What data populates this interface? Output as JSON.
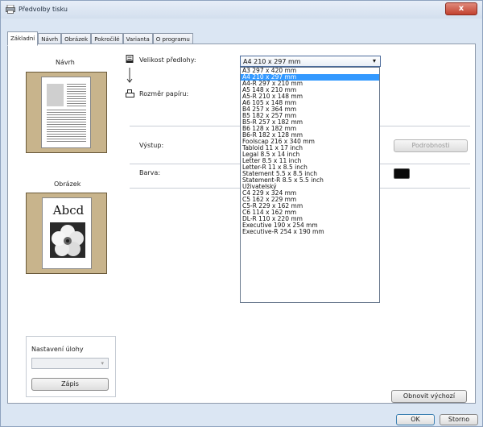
{
  "window": {
    "title": "Předvolby tisku",
    "close_label": "x"
  },
  "tabs": [
    {
      "label": "Základní"
    },
    {
      "label": "Návrh"
    },
    {
      "label": "Obrázek"
    },
    {
      "label": "Pokročilé"
    },
    {
      "label": "Varianta"
    },
    {
      "label": "O programu"
    }
  ],
  "left": {
    "layout_label": "Návrh",
    "image_label": "Obrázek",
    "image_text": "Abcd",
    "job_group_label": "Nastavení úlohy",
    "job_select_value": "",
    "save_button": "Zápis"
  },
  "form": {
    "template_size_label": "Velikost předlohy:",
    "template_size_value": "A4 210 x 297 mm",
    "paper_size_label": "Rozměr papíru:",
    "output_label": "Výstup:",
    "color_label": "Barva:",
    "details_button": "Podrobnosti"
  },
  "dropdown": {
    "selected_index": 1,
    "options": [
      "A3 297 x 420 mm",
      "A4 210 x 297 mm",
      "A4-R 297 x 210 mm",
      "A5 148 x 210 mm",
      "A5-R 210 x 148 mm",
      "A6 105 x 148 mm",
      "B4 257 x 364 mm",
      "B5 182 x 257 mm",
      "B5-R 257 x 182 mm",
      "B6 128 x 182 mm",
      "B6-R 182 x 128 mm",
      "Foolscap 216 x 340 mm",
      "Tabloid 11 x 17 inch",
      "Legal 8.5 x 14 inch",
      "Letter 8.5 x 11 inch",
      "Letter-R 11 x 8.5 inch",
      "Statement 5.5 x 8.5 inch",
      "Statement-R 8.5 x 5.5 inch",
      "Uživatelský",
      "C4 229 x 324 mm",
      "C5 162 x 229 mm",
      "C5-R 229 x 162 mm",
      "C6 114 x 162 mm",
      "DL-R 110 x 220 mm",
      "Executive 190 x 254 mm",
      "Executive-R 254 x 190 mm"
    ]
  },
  "footer": {
    "restore_button": "Obnovit výchozí",
    "ok_button": "OK",
    "cancel_button": "Storno"
  }
}
